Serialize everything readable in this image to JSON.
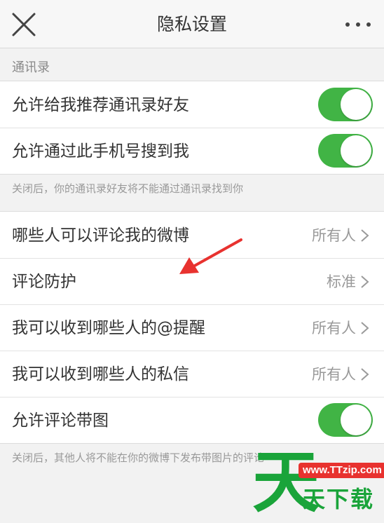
{
  "header": {
    "title": "隐私设置",
    "close_icon": "close-icon",
    "more_icon": "more-icon"
  },
  "contacts_section": {
    "title": "通讯录",
    "items": [
      {
        "label": "允许给我推荐通讯录好友",
        "toggle_on": true
      },
      {
        "label": "允许通过此手机号搜到我",
        "toggle_on": true
      }
    ],
    "note": "关闭后，你的通讯录好友将不能通过通讯录找到你"
  },
  "interaction_section": {
    "items": [
      {
        "label": "哪些人可以评论我的微博",
        "value": "所有人"
      },
      {
        "label": "评论防护",
        "value": "标准"
      },
      {
        "label": "我可以收到哪些人的@提醒",
        "value": "所有人"
      },
      {
        "label": "我可以收到哪些人的私信",
        "value": "所有人"
      },
      {
        "label": "允许评论带图",
        "toggle_on": true
      }
    ],
    "note": "关闭后，其他人将不能在你的微博下发布带图片的评论"
  },
  "watermark": {
    "big_char": "天",
    "url": "www.TTzip.com",
    "text": "天下载"
  },
  "colors": {
    "toggle_on": "#41b445",
    "annotation_arrow": "#e8322f",
    "watermark_green": "#1aa43a",
    "watermark_red": "#e8322f",
    "background": "#f2f2f2"
  }
}
